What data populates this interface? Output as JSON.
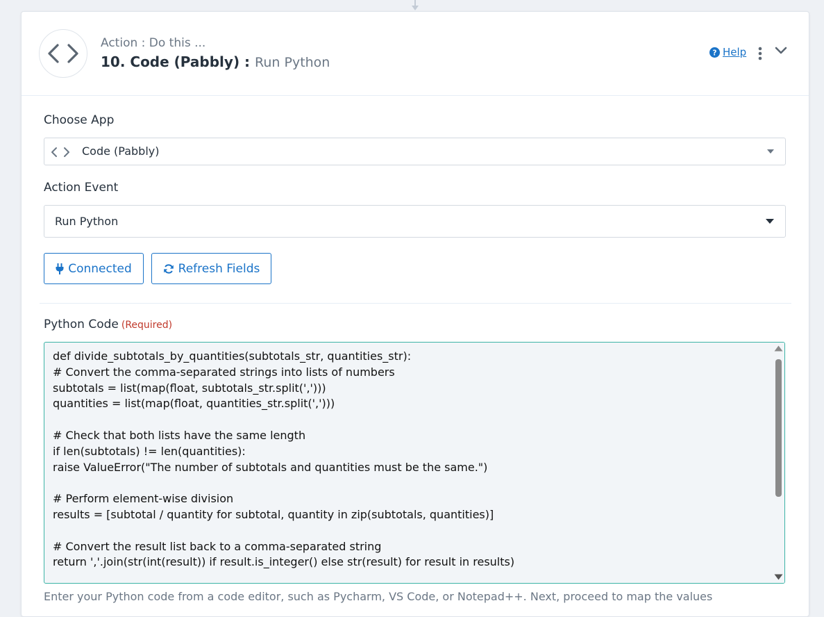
{
  "step": {
    "action_label": "Action : Do this ...",
    "title": "10. Code (Pabbly)",
    "separator": " : ",
    "event": "Run Python",
    "help_label": "Help"
  },
  "choose_app": {
    "label": "Choose App",
    "value": "Code (Pabbly)"
  },
  "action_event": {
    "label": "Action Event",
    "value": "Run Python"
  },
  "buttons": {
    "connected": "Connected",
    "refresh": "Refresh Fields"
  },
  "python_code": {
    "label": "Python Code",
    "required": "(Required)",
    "code": "def divide_subtotals_by_quantities(subtotals_str, quantities_str):\n# Convert the comma-separated strings into lists of numbers\nsubtotals = list(map(float, subtotals_str.split(',')))\nquantities = list(map(float, quantities_str.split(',')))\n\n# Check that both lists have the same length\nif len(subtotals) != len(quantities):\nraise ValueError(\"The number of subtotals and quantities must be the same.\")\n\n# Perform element-wise division\nresults = [subtotal / quantity for subtotal, quantity in zip(subtotals, quantities)]\n\n# Convert the result list back to a comma-separated string\nreturn ','.join(str(int(result)) if result.is_integer() else str(result) for result in results)",
    "hint": "Enter your Python code from a code editor, such as Pycharm, VS Code, or Notepad++. Next, proceed to map the values"
  },
  "colors": {
    "accent": "#1a73c8",
    "required": "#c0392b",
    "code_border": "#3bb3a6"
  }
}
